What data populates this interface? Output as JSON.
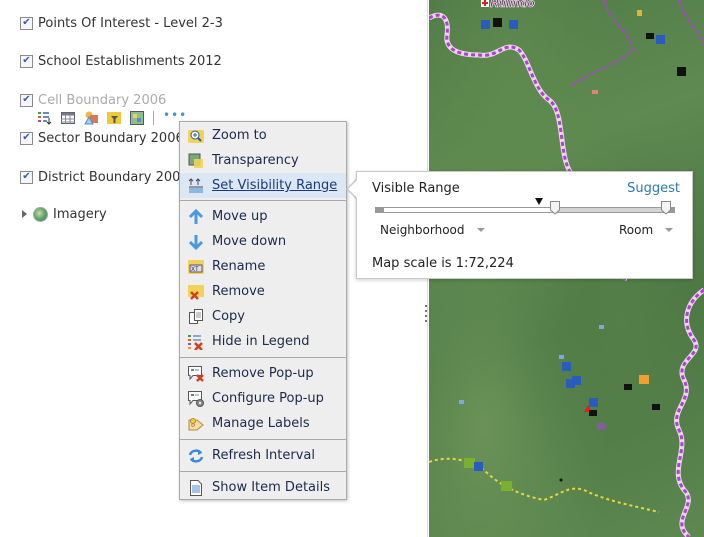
{
  "layers": [
    {
      "label": "Points Of Interest - Level 2-3",
      "checked": true,
      "dimmed": false
    },
    {
      "label": "School Establishments 2012",
      "checked": true,
      "dimmed": false
    },
    {
      "label": "Cell Boundary 2006",
      "checked": true,
      "dimmed": true
    },
    {
      "label": "Sector Boundary 2006",
      "checked": true,
      "dimmed": false
    },
    {
      "label": "District Boundary 2006",
      "checked": true,
      "dimmed": false
    }
  ],
  "checkmark": "✔",
  "layer_toolbar": {
    "icons": [
      "legend-icon",
      "table-icon",
      "change-style-icon",
      "filter-icon",
      "analysis-icon"
    ],
    "more": "•••"
  },
  "basemap_group": {
    "label": "Imagery"
  },
  "map": {
    "place_label": "Rulindo"
  },
  "context_menu": {
    "sections": [
      [
        {
          "label": "Zoom to",
          "icon": "zoom-to-icon"
        },
        {
          "label": "Transparency",
          "icon": "transparency-icon"
        },
        {
          "label": "Set Visibility Range",
          "icon": "visibility-range-icon",
          "active": true
        }
      ],
      [
        {
          "label": "Move up",
          "icon": "arrow-up-icon"
        },
        {
          "label": "Move down",
          "icon": "arrow-down-icon"
        },
        {
          "label": "Rename",
          "icon": "rename-icon"
        },
        {
          "label": "Remove",
          "icon": "remove-icon"
        },
        {
          "label": "Copy",
          "icon": "copy-icon"
        },
        {
          "label": "Hide in Legend",
          "icon": "hide-legend-icon"
        }
      ],
      [
        {
          "label": "Remove Pop-up",
          "icon": "remove-popup-icon"
        },
        {
          "label": "Configure Pop-up",
          "icon": "configure-popup-icon"
        },
        {
          "label": "Manage Labels",
          "icon": "manage-labels-icon"
        }
      ],
      [
        {
          "label": "Refresh Interval",
          "icon": "refresh-icon"
        }
      ],
      [
        {
          "label": "Show Item Details",
          "icon": "item-details-icon"
        }
      ]
    ]
  },
  "visibility_popup": {
    "title": "Visible Range",
    "suggest_label": "Suggest",
    "min_scale_label": "Neighborhood",
    "max_scale_label": "Room",
    "current_scale_text": "Map scale is 1:72,224",
    "range_min_fraction": 0.6,
    "range_max_fraction": 0.97,
    "current_scale_fraction": 0.545
  }
}
